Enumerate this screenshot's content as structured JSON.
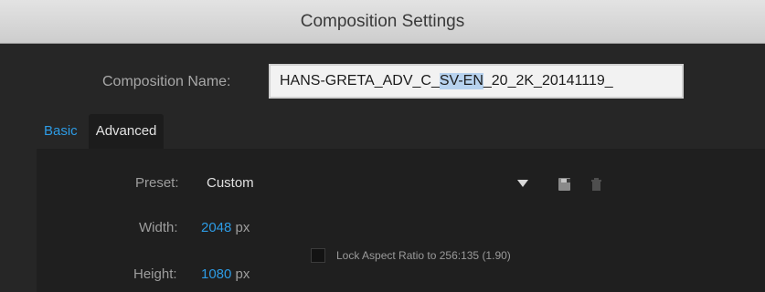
{
  "window": {
    "title": "Composition Settings"
  },
  "composition_name": {
    "label": "Composition Name:",
    "value_before": "HANS-GRETA_ADV_C_",
    "value_selected": "SV-EN",
    "value_after": "_20_2K_20141119_"
  },
  "tabs": [
    {
      "label": "Basic",
      "active": true
    },
    {
      "label": "Advanced",
      "active": false
    }
  ],
  "preset": {
    "label": "Preset:",
    "value": "Custom"
  },
  "width": {
    "label": "Width:",
    "value": "2048",
    "unit": "px"
  },
  "height": {
    "label": "Height:",
    "value": "1080",
    "unit": "px"
  },
  "lock_aspect": {
    "label": "Lock Aspect Ratio to 256:135 (1.90)",
    "checked": false
  },
  "icons": {
    "save": "save-preset-icon",
    "delete": "trash-icon",
    "dropdown": "chevron-down-icon"
  },
  "colors": {
    "accent": "#2d9be4",
    "selection": "#b7d2ee"
  }
}
